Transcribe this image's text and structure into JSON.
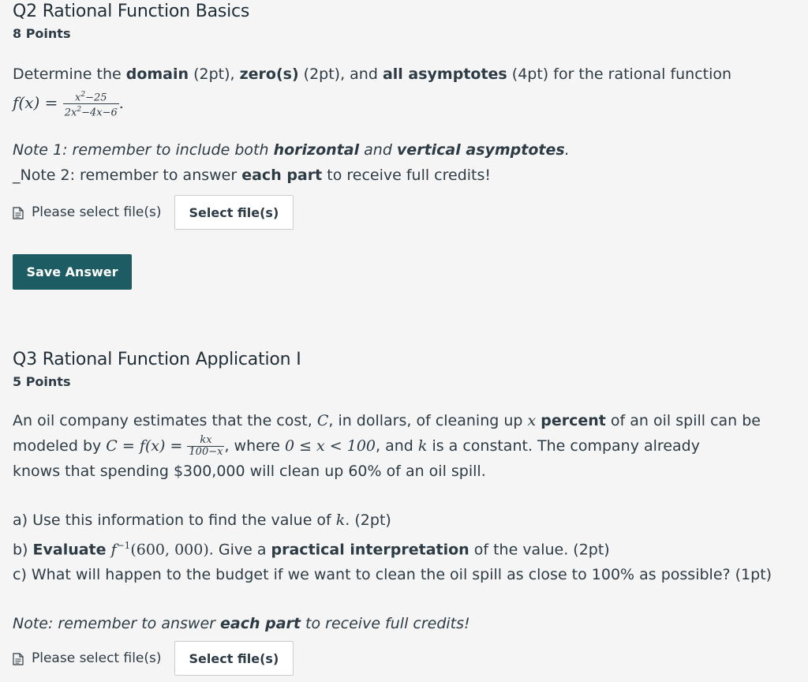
{
  "q2": {
    "title": "Q2 Rational Function Basics",
    "points": "8 Points",
    "prompt": {
      "t1": "Determine the ",
      "b1": "domain",
      "t2": " (2pt), ",
      "b2": "zero(s)",
      "t3": " (2pt), and ",
      "b3": "all asymptotes",
      "t4": " (4pt) for the rational function"
    },
    "function": {
      "lhs": "f(x) = ",
      "num_base": "x",
      "num_exp": "2",
      "num_rest": "−25",
      "den_a": "2x",
      "den_exp": "2",
      "den_rest": "−4x−6",
      "end": "."
    },
    "note1": {
      "t1": "Note 1: remember to include both ",
      "b1": "horizontal",
      "t2": " and ",
      "b2": "vertical asymptotes",
      "t3": "."
    },
    "note2": {
      "t1": "_Note 2: remember to answer ",
      "b1": "each part",
      "t2": " to receive full credits!"
    },
    "upload_label": "Please select file(s)",
    "select_button": "Select file(s)",
    "save_button": "Save Answer"
  },
  "q3": {
    "title": "Q3 Rational Function Application I",
    "points": "5 Points",
    "para": {
      "t1": "An oil company estimates that the cost, ",
      "m1": "C",
      "t2": ", in dollars, of cleaning up ",
      "m2": "x",
      "t3": " ",
      "b1": "percent",
      "t4": " of an oil spill can be",
      "t5": "modeled by ",
      "m3": "C = f(x) = ",
      "frac_num": "kx",
      "frac_den": "100−x",
      "t6": ", where ",
      "m4": "0 ≤ x < 100",
      "t7": ", and ",
      "m5": "k",
      "t8": " is a constant. The company already",
      "t9": "knows that spending $300,000 will clean up 60% of an oil spill."
    },
    "a": {
      "t1": "a) Use this information to find the value of ",
      "m1": "k",
      "t2": ". (2pt)"
    },
    "b": {
      "t1": "b) ",
      "b1": "Evaluate",
      "t2": " ",
      "m1": "f",
      "sup": "−1",
      "m2": "(600, 000)",
      "t3": ". Give a ",
      "b2": "practical interpretation",
      "t4": " of the value. (2pt)"
    },
    "c": "c) What will happen to the budget if we want to clean the oil spill as close to 100% as possible? (1pt)",
    "note": {
      "t1": "Note: remember to answer ",
      "b1": "each part",
      "t2": " to receive full credits!"
    },
    "upload_label": "Please select file(s)",
    "select_button": "Select file(s)"
  }
}
